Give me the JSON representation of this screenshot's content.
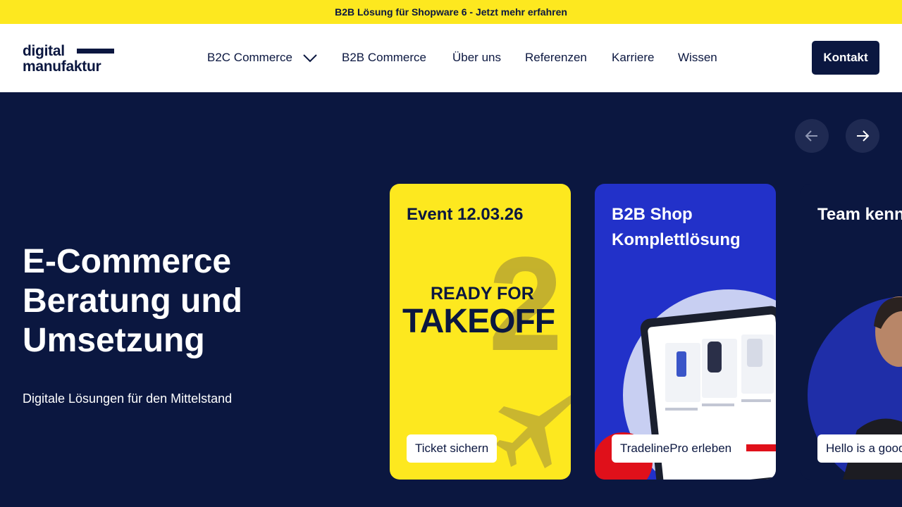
{
  "announcement": {
    "text": "B2B Lösung für Shopware 6 - Jetzt mehr erfahren"
  },
  "logo": {
    "line1": "digital",
    "line2": "manufaktur"
  },
  "nav": {
    "items": [
      {
        "label": "B2C Commerce"
      },
      {
        "label": "B2B Commerce"
      },
      {
        "label": "Über uns"
      },
      {
        "label": "Referenzen"
      },
      {
        "label": "Karriere"
      },
      {
        "label": "Wissen"
      }
    ],
    "cta": "Kontakt"
  },
  "hero": {
    "title": "E-Commerce Beratung und Umsetzung",
    "subtitle": "Digitale Lösungen für den Mittelstand"
  },
  "carousel": {
    "prev_icon": "arrow-left-icon",
    "next_icon": "arrow-right-icon",
    "cards": [
      {
        "title": "Event 12.03.26",
        "graphic": {
          "top": "READY FOR",
          "main": "TAKEOFF",
          "number": "2"
        },
        "button": "Ticket sichern"
      },
      {
        "title": "B2B Shop Komplettlösung",
        "button": "TradelinePro erleben"
      },
      {
        "title": "Team kennenlernen",
        "button": "Hello is a good"
      }
    ]
  },
  "colors": {
    "accent_yellow": "#fde81f",
    "navy": "#0b1740",
    "card_blue": "#2231c9"
  }
}
